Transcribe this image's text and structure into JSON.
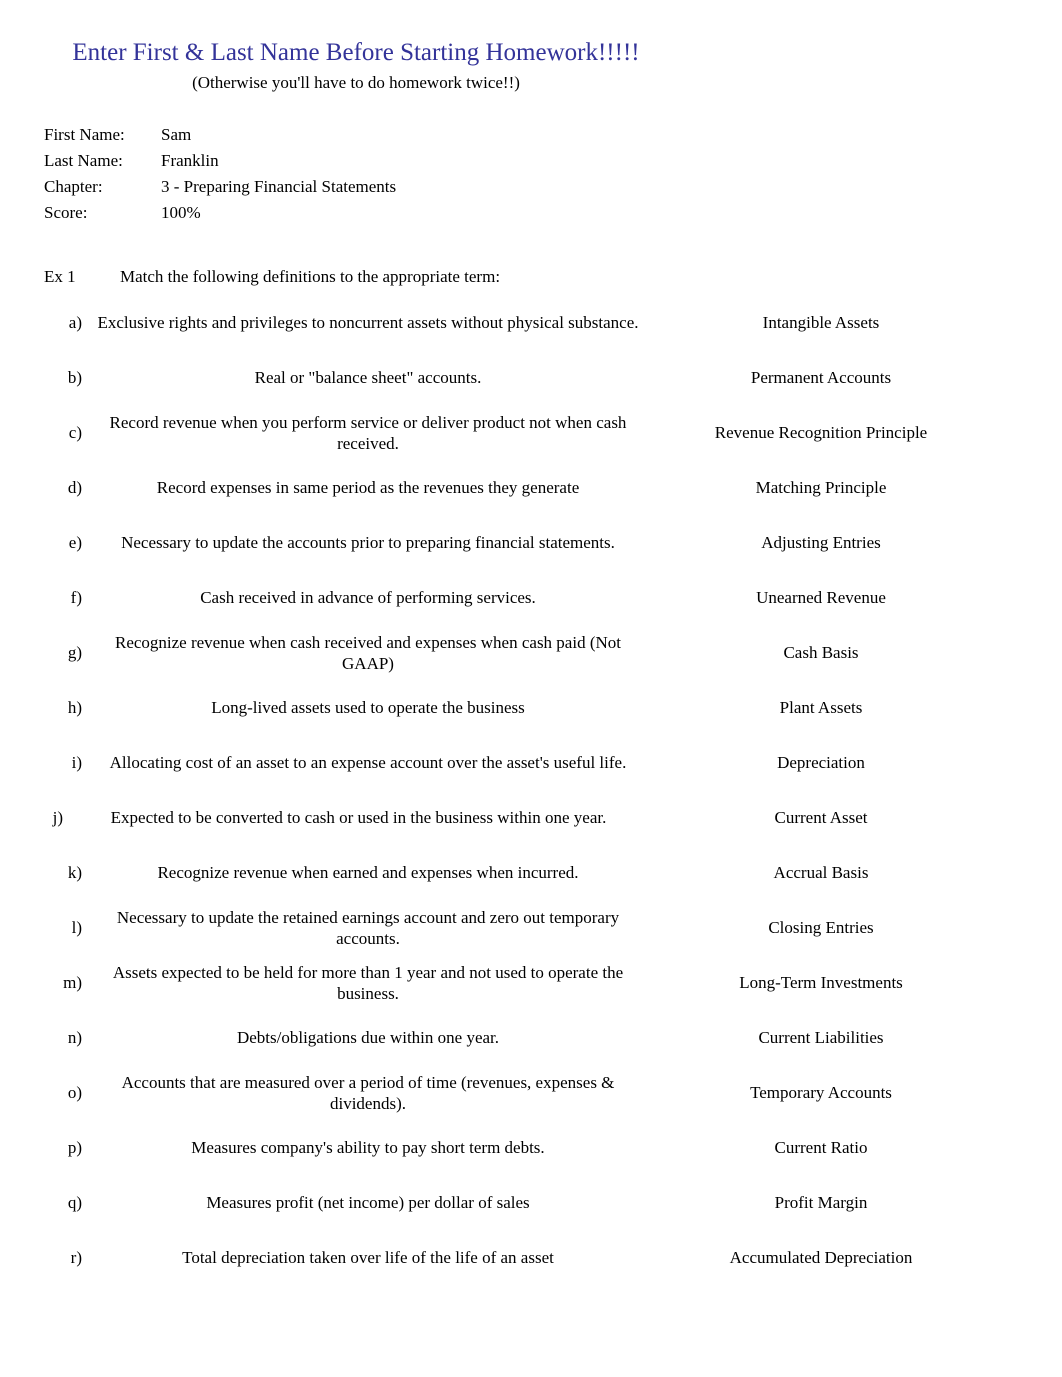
{
  "title": {
    "main": "Enter First & Last Name Before Starting Homework!!!!!",
    "sub": "(Otherwise you'll have to do homework twice!!)",
    "color": "#333399"
  },
  "info": {
    "first_name_label": "First Name:",
    "first_name_value": "Sam",
    "last_name_label": "Last Name:",
    "last_name_value": "Franklin",
    "chapter_label": "Chapter:",
    "chapter_value": "3 - Preparing Financial Statements",
    "score_label": "Score:",
    "score_value": "100%"
  },
  "exercise": {
    "label": "Ex 1",
    "instruction": "Match the following definitions to the appropriate term:"
  },
  "rows": [
    {
      "letter": "a)",
      "definition": "Exclusive rights and privileges to noncurrent assets without physical substance.",
      "answer": "Intangible Assets"
    },
    {
      "letter": "b)",
      "definition": "Real or \"balance sheet\" accounts.",
      "answer": "Permanent Accounts"
    },
    {
      "letter": "c)",
      "definition": "Record revenue when you perform service or deliver product not when cash received.",
      "answer": "Revenue Recognition Principle"
    },
    {
      "letter": "d)",
      "definition": "Record expenses in same period as the revenues they generate",
      "answer": "Matching Principle"
    },
    {
      "letter": "e)",
      "definition": "Necessary to update the accounts prior to preparing financial statements.",
      "answer": "Adjusting Entries"
    },
    {
      "letter": "f)",
      "definition": "Cash received in advance of performing services.",
      "answer": "Unearned Revenue"
    },
    {
      "letter": "g)",
      "definition": "Recognize revenue when cash received and expenses when cash paid (Not GAAP)",
      "answer": "Cash Basis"
    },
    {
      "letter": "h)",
      "definition": "Long-lived assets used to operate the business",
      "answer": "Plant Assets"
    },
    {
      "letter": "i)",
      "definition": "Allocating cost of an asset to an expense account over the asset's useful life.",
      "answer": "Depreciation"
    },
    {
      "letter": "j)",
      "definition": "Expected to be converted to cash or used in the business within one year.",
      "answer": "Current Asset",
      "wide": true
    },
    {
      "letter": "k)",
      "definition": "Recognize revenue when earned and expenses when incurred.",
      "answer": "Accrual Basis"
    },
    {
      "letter": "l)",
      "definition": "Necessary to update the retained earnings account and zero out temporary accounts.",
      "answer": "Closing Entries"
    },
    {
      "letter": "m)",
      "definition": "Assets expected to be held for more than 1 year and not used to operate the business.",
      "answer": "Long-Term Investments"
    },
    {
      "letter": "n)",
      "definition": "Debts/obligations due within one year.",
      "answer": "Current Liabilities"
    },
    {
      "letter": "o)",
      "definition": "Accounts that are measured over a period of time (revenues, expenses & dividends).",
      "answer": "Temporary Accounts"
    },
    {
      "letter": "p)",
      "definition": "Measures company's ability to pay short term debts.",
      "answer": "Current Ratio"
    },
    {
      "letter": "q)",
      "definition": "Measures profit (net income) per dollar of sales",
      "answer": "Profit Margin"
    },
    {
      "letter": "r)",
      "definition": "Total depreciation taken over life of the life of an asset",
      "answer": "Accumulated Depreciation"
    }
  ]
}
